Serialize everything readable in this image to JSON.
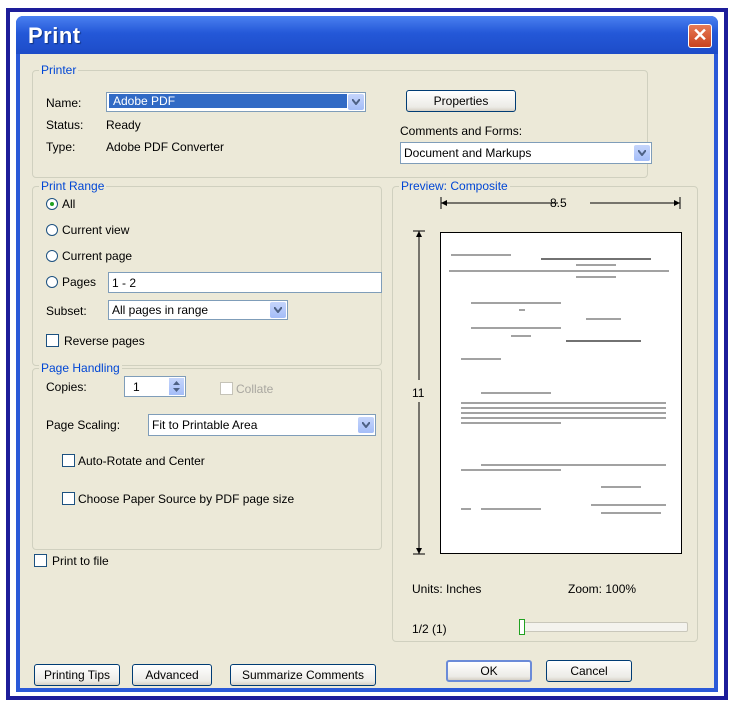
{
  "window": {
    "title": "Print"
  },
  "printer": {
    "legend": "Printer",
    "name_label": "Name:",
    "name_value": "Adobe PDF",
    "status_label": "Status:",
    "status_value": "Ready",
    "type_label": "Type:",
    "type_value": "Adobe PDF Converter",
    "properties_button": "Properties",
    "comments_label": "Comments and Forms:",
    "comments_value": "Document and Markups"
  },
  "print_range": {
    "legend": "Print Range",
    "options": [
      "All",
      "Current view",
      "Current page",
      "Pages"
    ],
    "selected": "All",
    "pages_value": "1 - 2",
    "subset_label": "Subset:",
    "subset_value": "All pages in range",
    "reverse_label": "Reverse pages"
  },
  "page_handling": {
    "legend": "Page Handling",
    "copies_label": "Copies:",
    "copies_value": "1",
    "collate_label": "Collate",
    "scaling_label": "Page Scaling:",
    "scaling_value": "Fit to Printable Area",
    "auto_rotate_label": "Auto-Rotate and Center",
    "paper_source_label": "Choose Paper Source by PDF page size"
  },
  "print_to_file_label": "Print to file",
  "preview": {
    "legend": "Preview: Composite",
    "width_dim": "8.5",
    "height_dim": "11",
    "units": "Units: Inches",
    "zoom": "Zoom: 100%",
    "page_indicator": "1/2 (1)"
  },
  "buttons": {
    "printing_tips": "Printing Tips",
    "advanced": "Advanced",
    "summarize": "Summarize Comments",
    "ok": "OK",
    "cancel": "Cancel"
  },
  "colors": {
    "titlebar": "#2458d8",
    "face": "#ece9d8",
    "legend_text": "#0046d5",
    "selection": "#316ac5"
  }
}
